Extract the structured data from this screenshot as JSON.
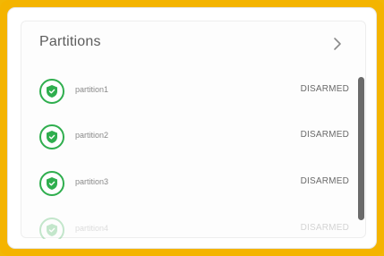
{
  "panel": {
    "title": "Partitions"
  },
  "partitions": [
    {
      "name": "partition1",
      "status": "DISARMED"
    },
    {
      "name": "partition2",
      "status": "DISARMED"
    },
    {
      "name": "partition3",
      "status": "DISARMED"
    },
    {
      "name": "partition4",
      "status": "DISARMED"
    }
  ],
  "colors": {
    "frame": "#f4b400",
    "shield_green": "#2fae4e",
    "text": "#5c5c5c"
  },
  "icons": {
    "chevron": "chevron-right-icon",
    "shield": "shield-icon"
  }
}
